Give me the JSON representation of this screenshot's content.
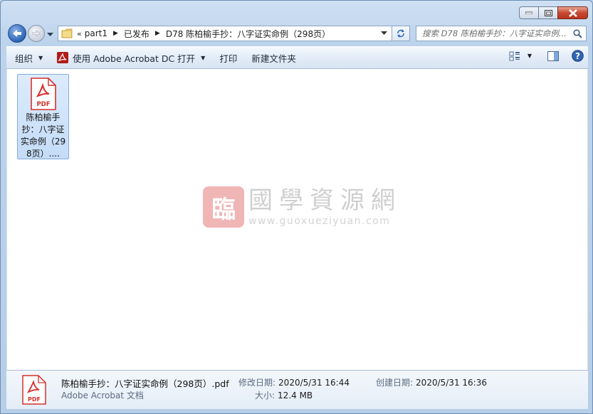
{
  "window": {
    "caption": {
      "minimize": "minimize",
      "maximize": "maximize",
      "close": "close"
    }
  },
  "address": {
    "overflow": "«",
    "crumbs": [
      "part1",
      "已发布",
      "D78 陈柏榆手抄：八字证实命例（298页）"
    ]
  },
  "search": {
    "placeholder": "搜索 D78 陈柏榆手抄：八字证实命例..."
  },
  "toolbar": {
    "organize": "组织",
    "open_with": "使用 Adobe Acrobat DC 打开",
    "print": "打印",
    "new_folder": "新建文件夹",
    "icons": [
      "view-options-icon",
      "preview-pane-icon",
      "help-icon"
    ]
  },
  "files": [
    {
      "name": "陈柏榆手抄：八字证实命例（298页）....",
      "icon": "pdf-icon",
      "badge": "PDF"
    }
  ],
  "watermark": {
    "seal": "臨",
    "title": "國學資源網",
    "url": "www.guoxueziyuan.com"
  },
  "details": {
    "filename": "陈柏榆手抄：八字证实命例（298页）.pdf",
    "filetype": "Adobe Acrobat 文档",
    "modified_label": "修改日期:",
    "modified_value": "2020/5/31 16:44",
    "size_label": "大小:",
    "size_value": "12.4 MB",
    "created_label": "创建日期:",
    "created_value": "2020/5/31 16:36"
  },
  "colors": {
    "accent": "#3a6fb5",
    "pdf_red": "#d4302b",
    "selection": "#cce3fb"
  }
}
